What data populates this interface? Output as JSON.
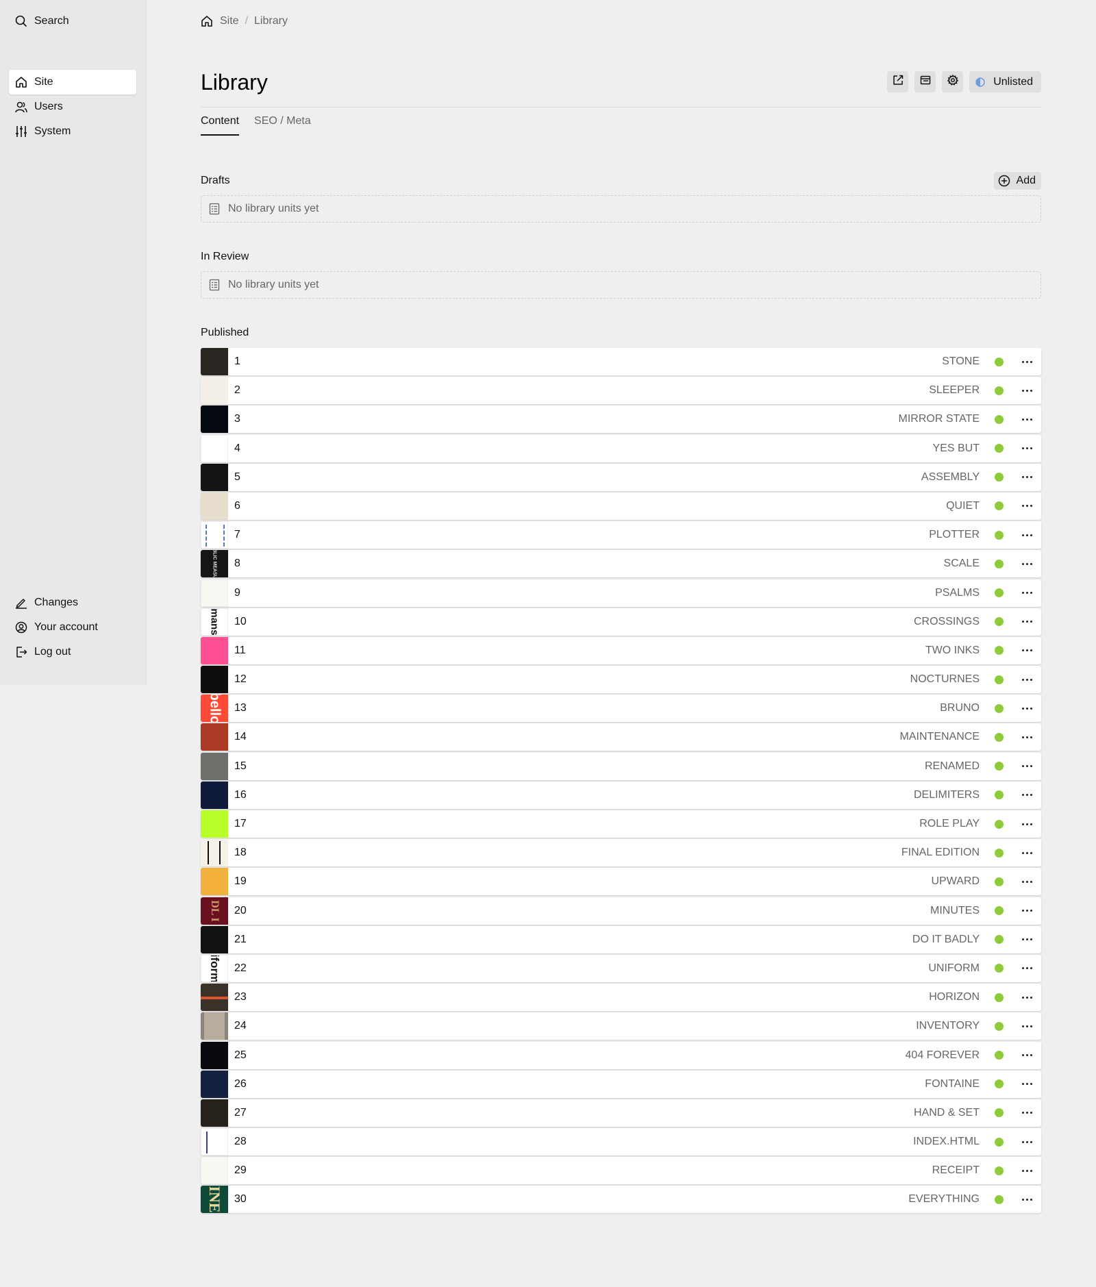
{
  "sidebar": {
    "search_label": "Search",
    "nav": [
      {
        "label": "Site",
        "icon": "home-icon",
        "active": true
      },
      {
        "label": "Users",
        "icon": "users-icon"
      },
      {
        "label": "System",
        "icon": "sliders-icon"
      }
    ],
    "bottom": [
      {
        "label": "Changes",
        "icon": "pencil-icon"
      },
      {
        "label": "Your account",
        "icon": "account-icon"
      },
      {
        "label": "Log out",
        "icon": "logout-icon"
      }
    ]
  },
  "breadcrumb": {
    "items": [
      "Site",
      "Library"
    ],
    "separator": "/"
  },
  "page": {
    "title": "Library",
    "status_label": "Unlisted"
  },
  "tabs": [
    {
      "label": "Content",
      "active": true
    },
    {
      "label": "SEO / Meta"
    }
  ],
  "sections": {
    "drafts": {
      "label": "Drafts",
      "add_label": "Add",
      "empty_text": "No library units yet"
    },
    "in_review": {
      "label": "In Review",
      "empty_text": "No library units yet"
    },
    "published": {
      "label": "Published"
    }
  },
  "colors": {
    "status_published": "#8ecb3a",
    "status_unlisted": "#6f9fe0"
  },
  "published_items": [
    {
      "num": "1",
      "info": "STONE",
      "thumb": "#2a2621"
    },
    {
      "num": "2",
      "info": "SLEEPER",
      "thumb": "#f3efe6"
    },
    {
      "num": "3",
      "info": "MIRROR STATE",
      "thumb": "#050a12"
    },
    {
      "num": "4",
      "info": "YES BUT",
      "thumb": "#ffffff"
    },
    {
      "num": "5",
      "info": "ASSEMBLY",
      "thumb": "#141414"
    },
    {
      "num": "6",
      "info": "QUIET",
      "thumb": "#e6ddcc"
    },
    {
      "num": "7",
      "info": "PLOTTER",
      "thumb": "#ffffff"
    },
    {
      "num": "8",
      "info": "SCALE",
      "thumb": "#151515"
    },
    {
      "num": "9",
      "info": "PSALMS",
      "thumb": "#f8f7f2"
    },
    {
      "num": "10",
      "info": "CROSSINGS",
      "thumb": "#ffffff"
    },
    {
      "num": "11",
      "info": "TWO INKS",
      "thumb": "#ff4f93"
    },
    {
      "num": "12",
      "info": "NOCTURNES",
      "thumb": "#0e0c0c"
    },
    {
      "num": "13",
      "info": "BRUNO",
      "thumb": "#ff4a35"
    },
    {
      "num": "14",
      "info": "MAINTENANCE",
      "thumb": "#ad3a25"
    },
    {
      "num": "15",
      "info": "RENAMED",
      "thumb": "#6e706b"
    },
    {
      "num": "16",
      "info": "DELIMITERS",
      "thumb": "#0f1a3c"
    },
    {
      "num": "17",
      "info": "ROLE PLAY",
      "thumb": "#b7ff2a"
    },
    {
      "num": "18",
      "info": "FINAL EDITION",
      "thumb": "#f5f1e6"
    },
    {
      "num": "19",
      "info": "UPWARD",
      "thumb": "#f2b13c"
    },
    {
      "num": "20",
      "info": "MINUTES",
      "thumb": "#6a101f"
    },
    {
      "num": "21",
      "info": "DO IT BADLY",
      "thumb": "#121212"
    },
    {
      "num": "22",
      "info": "UNIFORM",
      "thumb": "#ffffff"
    },
    {
      "num": "23",
      "info": "HORIZON",
      "thumb": "#3a3128"
    },
    {
      "num": "24",
      "info": "INVENTORY",
      "thumb": "#b6ad9e"
    },
    {
      "num": "25",
      "info": "404 FOREVER",
      "thumb": "#080a10"
    },
    {
      "num": "26",
      "info": "FONTAINE",
      "thumb": "#14223f"
    },
    {
      "num": "27",
      "info": "HAND & SET",
      "thumb": "#26211b"
    },
    {
      "num": "28",
      "info": "INDEX.HTML",
      "thumb": "#ffffff"
    },
    {
      "num": "29",
      "info": "RECEIPT",
      "thumb": "#faf8f2"
    },
    {
      "num": "30",
      "info": "EVERYTHING",
      "thumb": "#0e4a3a"
    }
  ]
}
